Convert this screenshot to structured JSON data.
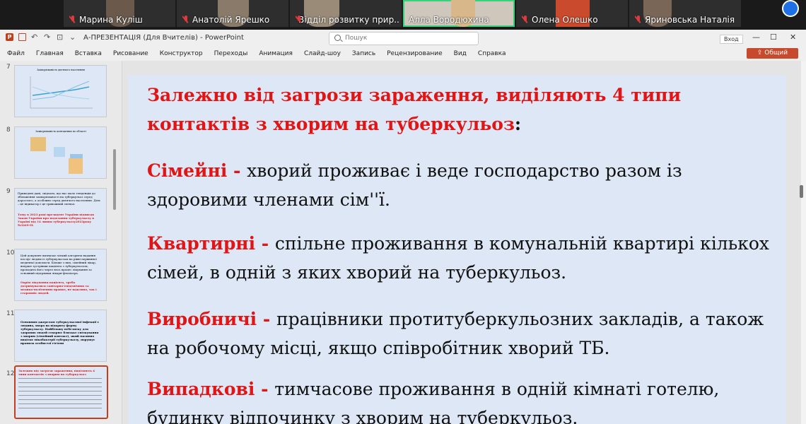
{
  "participants": [
    {
      "name": "Марина Куліш",
      "muted": true
    },
    {
      "name": "Анатолій Ярешко",
      "muted": true
    },
    {
      "name": "Відділ розвитку прир...",
      "muted": true
    },
    {
      "name": "Алла Вородюхина",
      "muted": false,
      "active": true
    },
    {
      "name": "Олена Олешко",
      "muted": true
    },
    {
      "name": "Яриновська Наталія",
      "muted": true
    }
  ],
  "titlebar": {
    "document_title": "А-ПРЕЗЕНТАЦІЯ (Для Вчителів)  -  PowerPoint",
    "search_placeholder": "Пошук",
    "sign_in": "Вход",
    "minimize": "—",
    "maximize": "☐",
    "close": "✕"
  },
  "menu": {
    "items": [
      "Файл",
      "Главная",
      "Вставка",
      "Рисование",
      "Конструктор",
      "Переходы",
      "Анимация",
      "Слайд-шоу",
      "Запись",
      "Рецензирование",
      "Вид",
      "Справка"
    ],
    "share": "Общий доступ"
  },
  "thumbnails": [
    {
      "number": "7",
      "title": "Захворюваність дитячого населення"
    },
    {
      "number": "8",
      "title": "Захворюваність контактних по області"
    },
    {
      "number": "9",
      "text": "Приведені дані, свідчать, що нас мало тенденція до збільшення захворюваності на туберкульоз серед дорослого, а особливо серед дитячого населення. Діти – це індикатор і це тривожний сигнал.",
      "red": "Тому в 2023 році президент України підписав Закон України про подолання туберкульозу в Україні від 14 липня туберкульозу2023року №3269-IX"
    },
    {
      "number": "10",
      "text": "Цей документ визначає чіткий алгоритм надання послуг людям із туберкульозом на рівні первинної медичної допомоги. Більше з них, сімейний лікар, вперше зустрівши пацієнта з туберкульозом, проходить його через весь процес лікування за основний підтримки лікаря-фтизіатра.",
      "red": "Окрім лікування пацієнта, треба дотримуватися санітарно-епідемічних та медико-полiтичних правил, не важливо, так і сторонніх людей."
    },
    {
      "number": "11",
      "text": "Основним джерелом туберкульозної інфекції є людина, хвора на відкриту форму туберкульозу. Найбільшу небезпеку для здорових людей створює близьке спілкування з хворим (сімейний контакт), який масивно виділяє мікобактерії туберкульозу, порушує правила особистої гігієни"
    },
    {
      "number": "12",
      "text": "Залежно від загрози зараження, виділяють 4 типи контактів з хворим на туберкульоз",
      "selected": true
    }
  ],
  "slide": {
    "heading_red": "Залежно від загрози зараження, виділяють 4 типи контактів з хворим на туберкульоз",
    "heading_colon": ":",
    "items": [
      {
        "term": " Сімейні - ",
        "text": "хворий проживає і веде господарство разом із здоровими членами сім''ї."
      },
      {
        "term": "Квартирні - ",
        "text": "спільне проживання в комунальній квартирі кількох сімей, в одній з яких  хворий на туберкульоз."
      },
      {
        "term": "Виробничі - ",
        "text": "працівники протитуберкульозних закладів, а також на робочому місці, якщо співробітник хворий ТБ."
      },
      {
        "term": "Випадкові - ",
        "text": "тимчасове проживання в одній кімнаті готелю, будинку відпочинку з хворим на туберкульоз."
      }
    ]
  },
  "colors": {
    "accent": "#c43e1c",
    "term": "#e01616",
    "slide_bg": "#dde7f5",
    "active_speaker": "#39d17a"
  }
}
